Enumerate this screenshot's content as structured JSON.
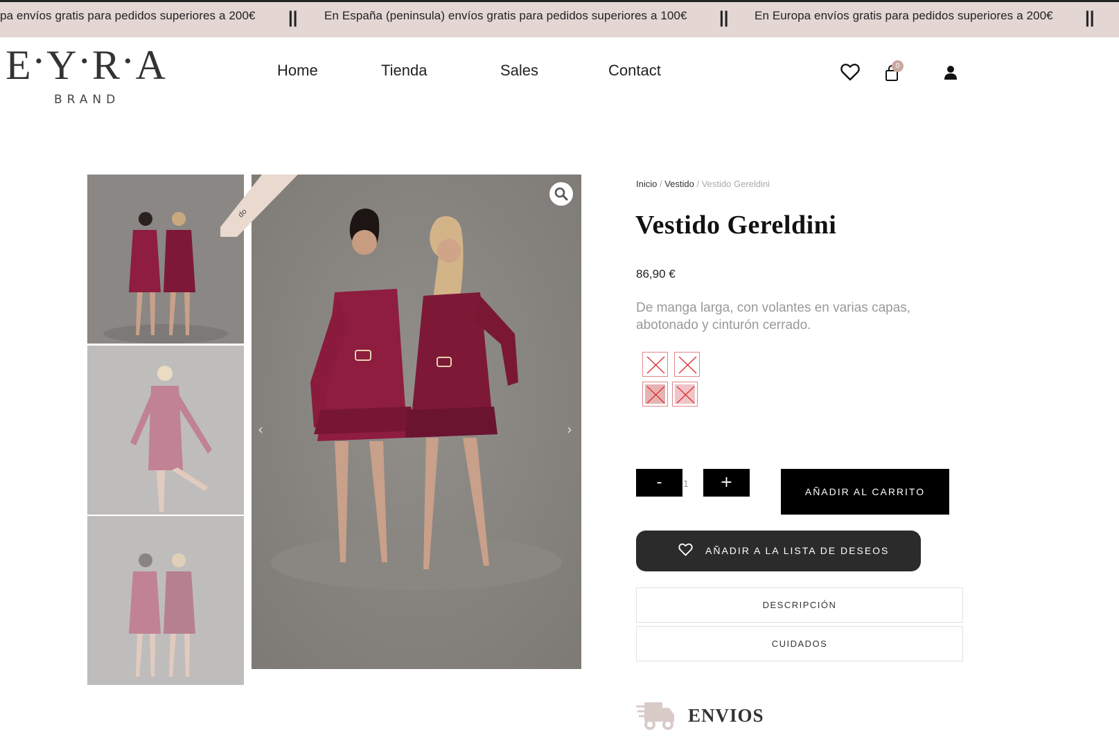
{
  "announcement": {
    "messages": [
      "pa envíos gratis para pedidos superiores a 200€",
      "En España (peninsula) envíos gratis para pedidos superiores a 100€",
      "En Europa envíos gratis para pedidos superiores a 200€"
    ],
    "separator": "||"
  },
  "header": {
    "logo_letters": [
      "E",
      "Y",
      "R",
      "A"
    ],
    "logo_subtitle": "BRAND",
    "nav": [
      "Home",
      "Tienda",
      "Sales",
      "Contact"
    ],
    "cart_count": "0",
    "icons": [
      "heart-icon",
      "shopping-bag-icon",
      "user-icon"
    ]
  },
  "gallery": {
    "ribbon_text": "do",
    "prev_arrow": "‹",
    "next_arrow": "›"
  },
  "product": {
    "breadcrumb": {
      "home": "Inicio",
      "category": "Vestido",
      "current": "Vestido Gereldini",
      "sep": " / "
    },
    "title": "Vestido Gereldini",
    "price": "86,90 €",
    "description": "De manga larga, con volantes en varias capas, abotonado y cinturón cerrado.",
    "swatches": [
      {
        "color": "#ffffff",
        "available": false
      },
      {
        "color": "#ffffff",
        "available": false
      },
      {
        "color": "#e6b3b3",
        "available": false
      },
      {
        "color": "#f0c4c8",
        "available": false
      }
    ],
    "quantity": {
      "minus": "-",
      "value": "1",
      "plus": "+"
    },
    "add_to_cart": "AÑADIR AL CARRITO",
    "wishlist": "AÑADIR A LA LISTA DE DESEOS",
    "tabs": [
      "DESCRIPCIÓN",
      "CUIDADOS"
    ],
    "shipping_heading": "ENVIOS"
  },
  "colors": {
    "topbar_bg": "#e3d6d3",
    "dress": "#8e1d3f",
    "wishlist_bg": "#2b2b2b",
    "badge": "#c9a8a0"
  }
}
